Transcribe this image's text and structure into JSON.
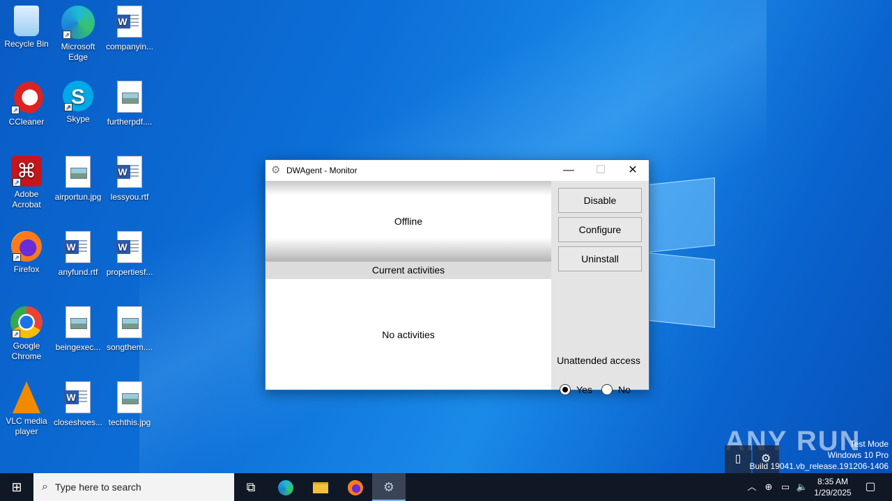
{
  "desktop": {
    "icons": [
      {
        "label": "Recycle Bin",
        "icon": "recycle-bin-icon"
      },
      {
        "label": "Microsoft Edge",
        "icon": "edge-icon"
      },
      {
        "label": "companyin...",
        "icon": "word-doc-icon"
      },
      {
        "label": "CCleaner",
        "icon": "ccleaner-icon"
      },
      {
        "label": "Skype",
        "icon": "skype-icon"
      },
      {
        "label": "furtherpdf....",
        "icon": "image-file-icon"
      },
      {
        "label": "Adobe Acrobat",
        "icon": "acrobat-icon"
      },
      {
        "label": "airportun.jpg",
        "icon": "image-file-icon"
      },
      {
        "label": "lessyou.rtf",
        "icon": "word-doc-icon"
      },
      {
        "label": "Firefox",
        "icon": "firefox-icon"
      },
      {
        "label": "anyfund.rtf",
        "icon": "word-doc-icon"
      },
      {
        "label": "propertiesf...",
        "icon": "word-doc-icon"
      },
      {
        "label": "Google Chrome",
        "icon": "chrome-icon"
      },
      {
        "label": "beingexec...",
        "icon": "image-file-icon"
      },
      {
        "label": "songthem....",
        "icon": "image-file-icon"
      },
      {
        "label": "VLC media player",
        "icon": "vlc-icon"
      },
      {
        "label": "closeshoes...",
        "icon": "word-doc-icon"
      },
      {
        "label": "techthis.jpg",
        "icon": "image-file-icon"
      }
    ]
  },
  "window": {
    "title": "DWAgent - Monitor",
    "status": "Offline",
    "activities_header": "Current activities",
    "activities_body": "No activities",
    "buttons": {
      "disable": "Disable",
      "configure": "Configure",
      "uninstall": "Uninstall"
    },
    "unattended_label": "Unattended access",
    "radio_yes": "Yes",
    "radio_no": "No",
    "unattended_selected": "Yes"
  },
  "taskbar": {
    "search_placeholder": "Type here to search",
    "time": "8:35 AM",
    "date": "1/29/2025"
  },
  "overlay": {
    "watermark": "ANY RUN",
    "test_mode": "Test Mode",
    "edition": "Windows 10 Pro",
    "build": "Build 19041.vb_release.191206-1406"
  },
  "colors": {
    "accent": "#1e78d0",
    "taskbar": "#101826",
    "desktop": "#0c6fd8"
  }
}
